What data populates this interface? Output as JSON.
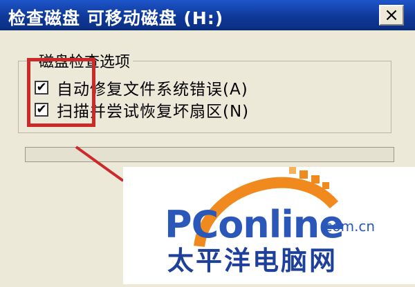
{
  "window": {
    "title": "检查磁盘 可移动磁盘 (H:)",
    "close_label": "×"
  },
  "group": {
    "title": "磁盘检查选项",
    "options": [
      {
        "label": "自动修复文件系统错误(A)",
        "checked": true
      },
      {
        "label": "扫描并尝试恢复坏扇区(N)",
        "checked": true
      }
    ]
  },
  "watermark": {
    "brand": "PConline",
    "domain": ".com.cn",
    "name_cn": "太平洋电脑网"
  },
  "colors": {
    "highlight": "#cc2a2a",
    "brand_orange": "#f08a1e",
    "brand_blue": "#2a57b8"
  }
}
